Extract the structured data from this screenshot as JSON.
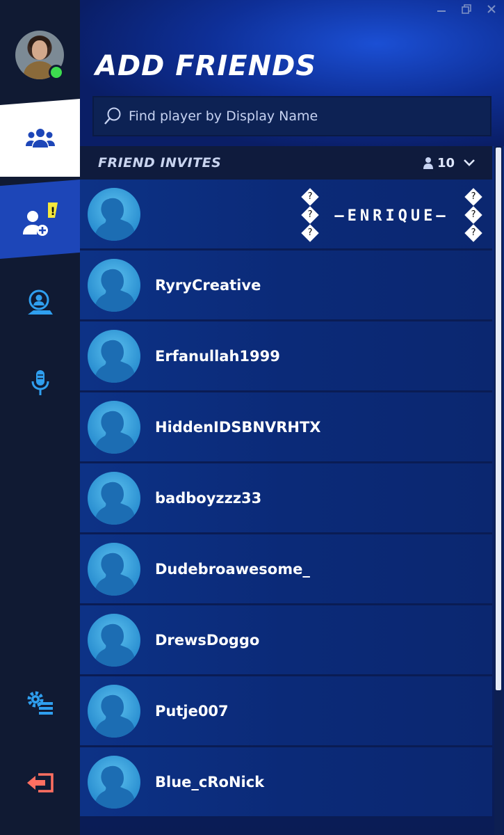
{
  "window": {
    "controls": [
      "minimize-icon",
      "restore-icon",
      "close-icon"
    ]
  },
  "sidebar": {
    "profile": {
      "avatar": "player-avatar",
      "status": "online",
      "status_color": "#3ddc4f"
    },
    "items": [
      {
        "id": "friends",
        "icon": "friends-icon",
        "active": false
      },
      {
        "id": "add-friends",
        "icon": "add-friend-icon",
        "badge": "!",
        "active": true
      },
      {
        "id": "creator",
        "icon": "creator-support-icon"
      },
      {
        "id": "voice",
        "icon": "microphone-icon"
      },
      {
        "id": "settings",
        "icon": "settings-list-icon"
      },
      {
        "id": "exit",
        "icon": "exit-icon"
      }
    ]
  },
  "main": {
    "title": "ADD FRIENDS",
    "search": {
      "placeholder": "Find player by Display Name",
      "value": ""
    },
    "invites": {
      "title": "FRIEND INVITES",
      "count": "10",
      "rows": [
        {
          "name": "",
          "display_decor": "—ENRIQUE—",
          "glyph": "?"
        },
        {
          "name": "RyryCreative"
        },
        {
          "name": "Erfanullah1999"
        },
        {
          "name": "HiddenIDSBNVRHTX"
        },
        {
          "name": "badboyzzz33"
        },
        {
          "name": "Dudebroawesome_"
        },
        {
          "name": "DrewsDoggo"
        },
        {
          "name": "Putje007"
        },
        {
          "name": "Blue_cRoNick"
        }
      ]
    }
  },
  "colors": {
    "accent_blue": "#1d46b8",
    "sidebar_icon_blue": "#2f9fef",
    "exit_icon": "#ff6f61",
    "badge_yellow": "#f5e83b"
  }
}
